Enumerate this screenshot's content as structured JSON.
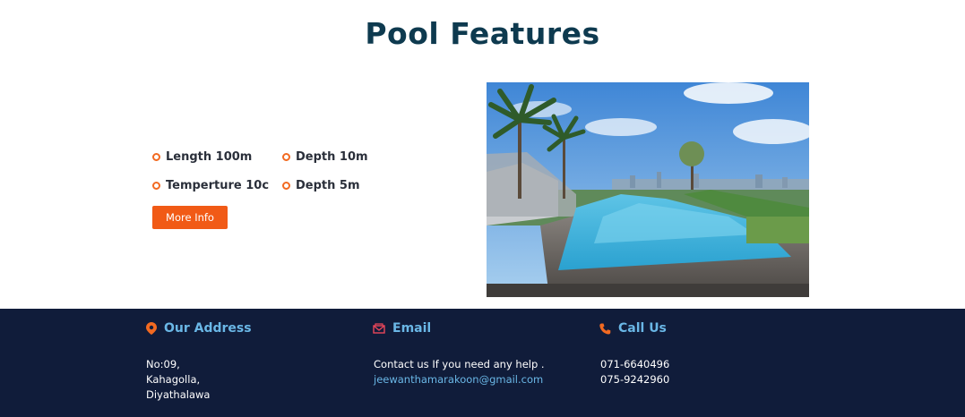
{
  "section": {
    "title": "Pool Features"
  },
  "features": {
    "items": [
      "Length 100m",
      "Depth 10m",
      "Temperture 10c",
      "Depth 5m"
    ],
    "button_label": "More Info"
  },
  "photo": {
    "alt": "pool image"
  },
  "footer": {
    "address": {
      "heading": "Our Address",
      "line1": "No:09,",
      "line2": "Kahagolla,",
      "line3": "Diyathalawa"
    },
    "email": {
      "heading": "Email",
      "text": "Contact us If you need any help .",
      "address": "jeewanthamarakoon@gmail.com"
    },
    "call": {
      "heading": "Call Us",
      "phone1": "071-6640496",
      "phone2": "075-9242960"
    }
  },
  "colors": {
    "accent": "#f15a16",
    "footer_bg": "#101c3a",
    "heading_blue": "#6ab7e6",
    "title": "#0e3a4f"
  }
}
